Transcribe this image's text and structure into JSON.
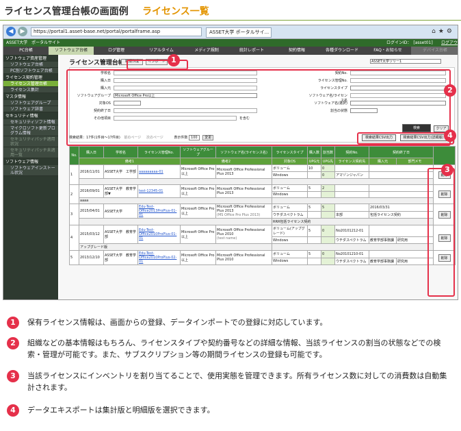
{
  "header": {
    "title": "ライセンス管理台帳の画面例",
    "subtitle": "ライセンス一覧"
  },
  "browser": {
    "address": "https://portal1.asset-base.net/portal/portalframe.asp",
    "tab": "ASSET大学 ポータルサイ..."
  },
  "app": {
    "brand": "ASSET大学　ポータルサイト",
    "login": "ログインID：　[asset01]",
    "logout": "ログアウト"
  },
  "menu": [
    "PC台帳",
    "ソフトウェア台帳",
    "ログ管理",
    "リアルタイム",
    "メディア規制",
    "統計レポート",
    "契約情報",
    "各種ダウンロード",
    "FAQ・お知らせ",
    "デバイス台帳"
  ],
  "sidebar": [
    {
      "h": "ソフトウェア資産管理",
      "items": [
        "ソフトウェア台帳",
        "PC別ソフトウェア台帳"
      ]
    },
    {
      "h": "ライセンス契約管理",
      "items": [
        "ライセンス管理台帳",
        "ライセンス集計"
      ]
    },
    {
      "h": "マスタ情報",
      "items": [
        "ソフトウェアグループ",
        "ソフトウェア辞書"
      ]
    },
    {
      "h": "セキュリティ情報",
      "items": [
        "セキュリティソフト情報",
        "マイクロソフト更新プログラム情報",
        "セキュリティパッチ適用状況",
        "セキュリティパッチ未適用一覧"
      ]
    },
    {
      "h": "ソフトウェア情報",
      "items": [
        "ソフトウェアインストール状況"
      ]
    }
  ],
  "form": {
    "title": "ライセンス管理台帳",
    "new_btn": "新規作成",
    "import_btn": "インポート",
    "tree_select": "ASSET大学ツリー1",
    "left_labels": [
      "学校名",
      "購入日",
      "購入元",
      "ソフトウェアグループ",
      "対象OS",
      "契約終了日",
      "その他項目"
    ],
    "group_value": "Microsoft Office Pro以上",
    "other_suffix": "を含む",
    "right_labels": [
      "契約No.",
      "ライセンス管理No.",
      "ライセンスタイプ",
      "ソフトウェア名/ライセンス名",
      "ソフトウェア名(選択)",
      "割当の状態"
    ],
    "search": "検索",
    "clear": "クリア"
  },
  "results": {
    "summary": "検索結果：17件(1件目〜17件目)",
    "prev": "前のページ",
    "next": "次のページ",
    "per_page_label": "表示件数",
    "per_page": "100",
    "change": "変更",
    "csv1": "検索結果CSV出力",
    "csv2": "検索結果CSV出力(詳細版)"
  },
  "table": {
    "h1": [
      "No.",
      "購入日",
      "学校名",
      "ライセンス管理No.",
      "ソフトウェアグループ",
      "ソフトウェア名(ライセンス名)",
      "ライセンスタイプ",
      "購入数",
      "割当数",
      "契約No.",
      "契約終了日",
      ""
    ],
    "h2": [
      "備考1",
      "備考2",
      "対象OS",
      "UPG元",
      "UPG先",
      "ライセンス契約先",
      "購入元",
      "部門メモ"
    ],
    "rows": [
      {
        "no": "1",
        "date": "2016/11/01",
        "school": "ASSET大学　工学部",
        "id": "aaaaaaaaa-01",
        "group": "Microsoft Office Pro以上",
        "sw": "Microsoft Office Professional Plus 2013",
        "type": "ボリューム",
        "os": "Windows",
        "qty": "10",
        "asg": "0",
        "asg2": "0",
        "contract": "",
        "end": "",
        "vendor": "アマゾンジャパン",
        "memo": "",
        "note1": "",
        "note2": ""
      },
      {
        "no": "2",
        "date": "2016/09/01",
        "school": "ASSET大学　教育学部▼",
        "id": "test-12345-01",
        "group": "Microsoft Office Pro以上",
        "sw": "Microsoft Office Professional Plus 2013",
        "type": "ボリューム",
        "os": "Windows",
        "qty": "5",
        "asg": "2",
        "asg2": "",
        "contract": "",
        "end": "",
        "vendor": "",
        "memo": "",
        "note1": "aaaa",
        "note2": ""
      },
      {
        "no": "3",
        "date": "2015/04/01",
        "school": "ASSET大学",
        "id": "Edu-Test-Office2013ProPlus-01-01",
        "group": "Microsoft Office Pro以上",
        "sw": "Microsoft Office Professional Plus 2013",
        "sw2": "(MS Office Pro Plus 2013)",
        "type": "ボリューム",
        "os": "ウチダスペクトラム",
        "qty": "5",
        "asg": "5",
        "asg2": "",
        "contract": "",
        "end": "2016/03/31",
        "vendor": "本部",
        "memo": "包括ライセンス契約",
        "note1": "",
        "note2": "RRR包括ライセンス契約"
      },
      {
        "no": "4",
        "date": "2015/03/12",
        "school": "ASSET大学　教育学部",
        "id": "Edu-Test-Office2010ProPlus-01-01",
        "group": "Microsoft Office Pro以上",
        "sw": "Microsoft Office Professional Plus 2010",
        "sw2": "(test name)",
        "type": "ボリューム(アップグレード)",
        "os": "Windows",
        "qty": "5",
        "asg": "0",
        "asg2": "",
        "contract": "No20101212-01",
        "end": "",
        "vendor": "ウチダスペクトラム",
        "memo": "研究用",
        "vendor2": "教育学部事務課",
        "note1": "アップグレード版",
        "note2": ""
      },
      {
        "no": "5",
        "date": "2013/12/10",
        "school": "ASSET大学　教育学部",
        "id": "Edu-Test-Office2010ProPlus-02-01",
        "group": "Microsoft Office Pro以上",
        "sw": "Microsoft Office Professional Plus 2010",
        "sw2": "",
        "type": "ボリューム",
        "os": "Windows",
        "qty": "5",
        "asg": "0",
        "asg2": "",
        "contract": "No20101210-01",
        "end": "",
        "vendor": "ウチダスペクトラム",
        "memo": "研究用",
        "vendor2": "教育学部事務課",
        "note1": "",
        "note2": ""
      }
    ],
    "delete": "削除"
  },
  "callouts": [
    "1",
    "2",
    "3",
    "4"
  ],
  "captions": [
    {
      "n": "1",
      "text": "保有ライセンス情報は、画面からの登録、データインポートでの登録に対応しています。"
    },
    {
      "n": "2",
      "text": "組織などの基本情報はもちろん、ライセンスタイプや契約番号などの詳細な情報、当該ライセンスの割当の状態などでの検索・管理が可能です。また、サブスクリプション等の期間ライセンスの登録も可能です。"
    },
    {
      "n": "3",
      "text": "当該ライセンスにインベントリを割り当てることで、使用実態を管理できます。所有ライセンス数に対しての消費数は自動集計されます。"
    },
    {
      "n": "4",
      "text": "データエキスポートは集計版と明細版を選択できます。"
    }
  ]
}
